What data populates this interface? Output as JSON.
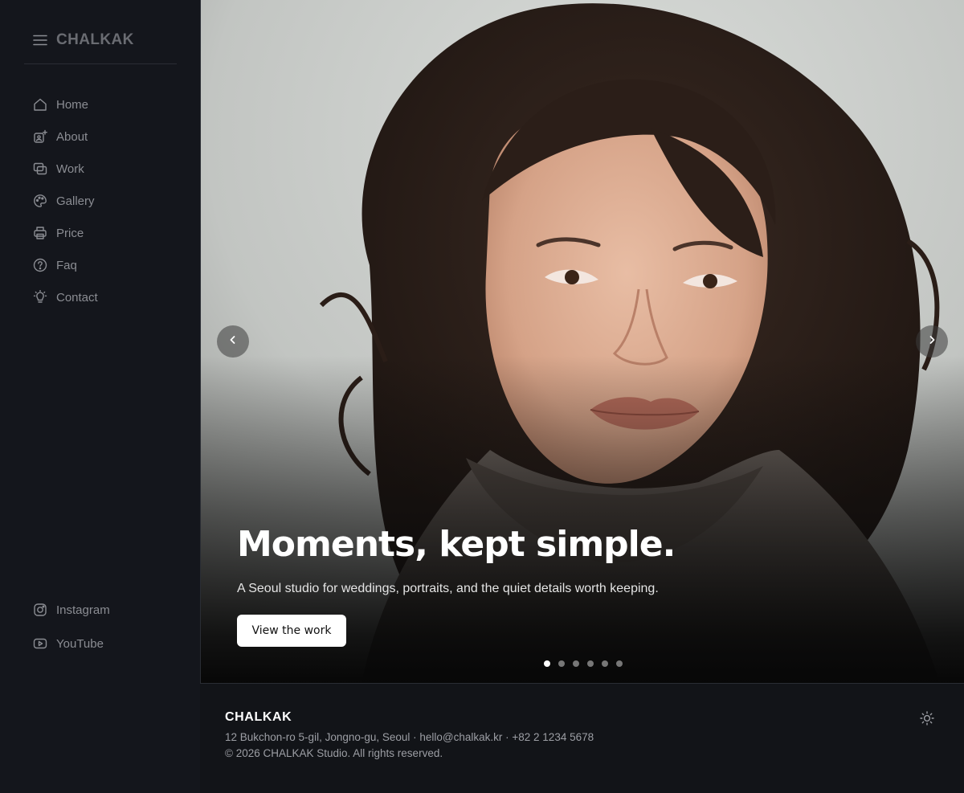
{
  "sidebar": {
    "brand": "CHALKAK",
    "menu_icon": "hamburger-menu-icon",
    "items": [
      {
        "label": "Home",
        "icon": "home-icon"
      },
      {
        "label": "About",
        "icon": "about-icon"
      },
      {
        "label": "Work",
        "icon": "work-icon"
      },
      {
        "label": "Gallery",
        "icon": "palette-icon"
      },
      {
        "label": "Price",
        "icon": "printer-icon"
      },
      {
        "label": "Faq",
        "icon": "question-circle-icon"
      },
      {
        "label": "Contact",
        "icon": "lightbulb-icon"
      }
    ],
    "social": [
      {
        "label": "Instagram",
        "icon": "instagram-icon"
      },
      {
        "label": "YouTube",
        "icon": "youtube-icon"
      }
    ]
  },
  "hero": {
    "title": "Moments, kept simple.",
    "subtitle": "A Seoul studio for weddings, portraits, and the quiet details worth keeping.",
    "cta_label": "View the work",
    "slide_count": 6,
    "active_slide": 1,
    "prev_icon": "chevron-left-icon",
    "next_icon": "chevron-right-icon"
  },
  "footer": {
    "brand": "CHALKAK",
    "address_line": "12 Bukchon-ro 5-gil, Jongno-gu, Seoul · hello@chalkak.kr · +82 2 1234 5678",
    "copyright": "© 2026 CHALKAK Studio. All rights reserved.",
    "theme_icon": "sun-icon"
  },
  "colors": {
    "sidebar_bg": "#14161c",
    "page_bg": "#121418",
    "nav_text": "#8b8d93",
    "hero_text": "#ffffff"
  }
}
